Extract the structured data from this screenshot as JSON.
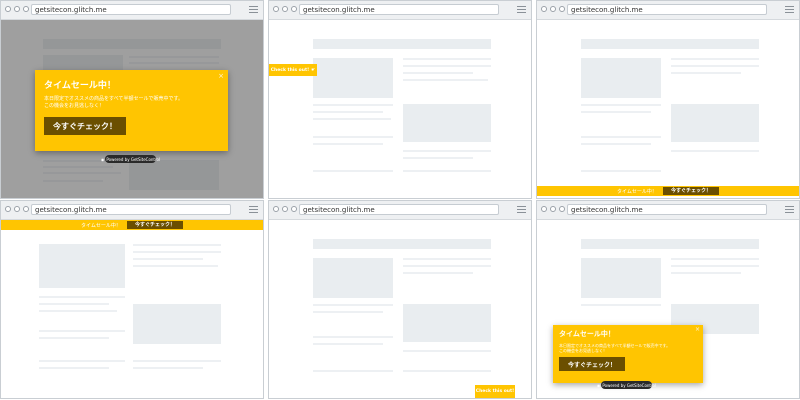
{
  "browser": {
    "url": "getsitecon.glitch.me"
  },
  "popup": {
    "title": "タイムセール中！",
    "message_line1": "本日限定でオススメの商品をすべて半額セールで販売中です。",
    "message_line2": "この機会をお見逃しなく！",
    "cta_label": "今すぐチェック！",
    "close_icon": "×",
    "powered_by": "Powered by GetSiteControl"
  },
  "top_bar": {
    "text": "タイムセール中！",
    "cta_label": "今すぐチェック！"
  },
  "bottom_bar": {
    "text": "タイムセール中！",
    "cta_label": "今すぐチェック！"
  },
  "side_tab": {
    "label": "Check this out!",
    "icon": "hand-icon"
  },
  "corner_tab": {
    "label": "Check this out!"
  },
  "colors": {
    "accent": "#ffc501",
    "cta_bg": "#6b4f00",
    "overlay": "#505050"
  }
}
